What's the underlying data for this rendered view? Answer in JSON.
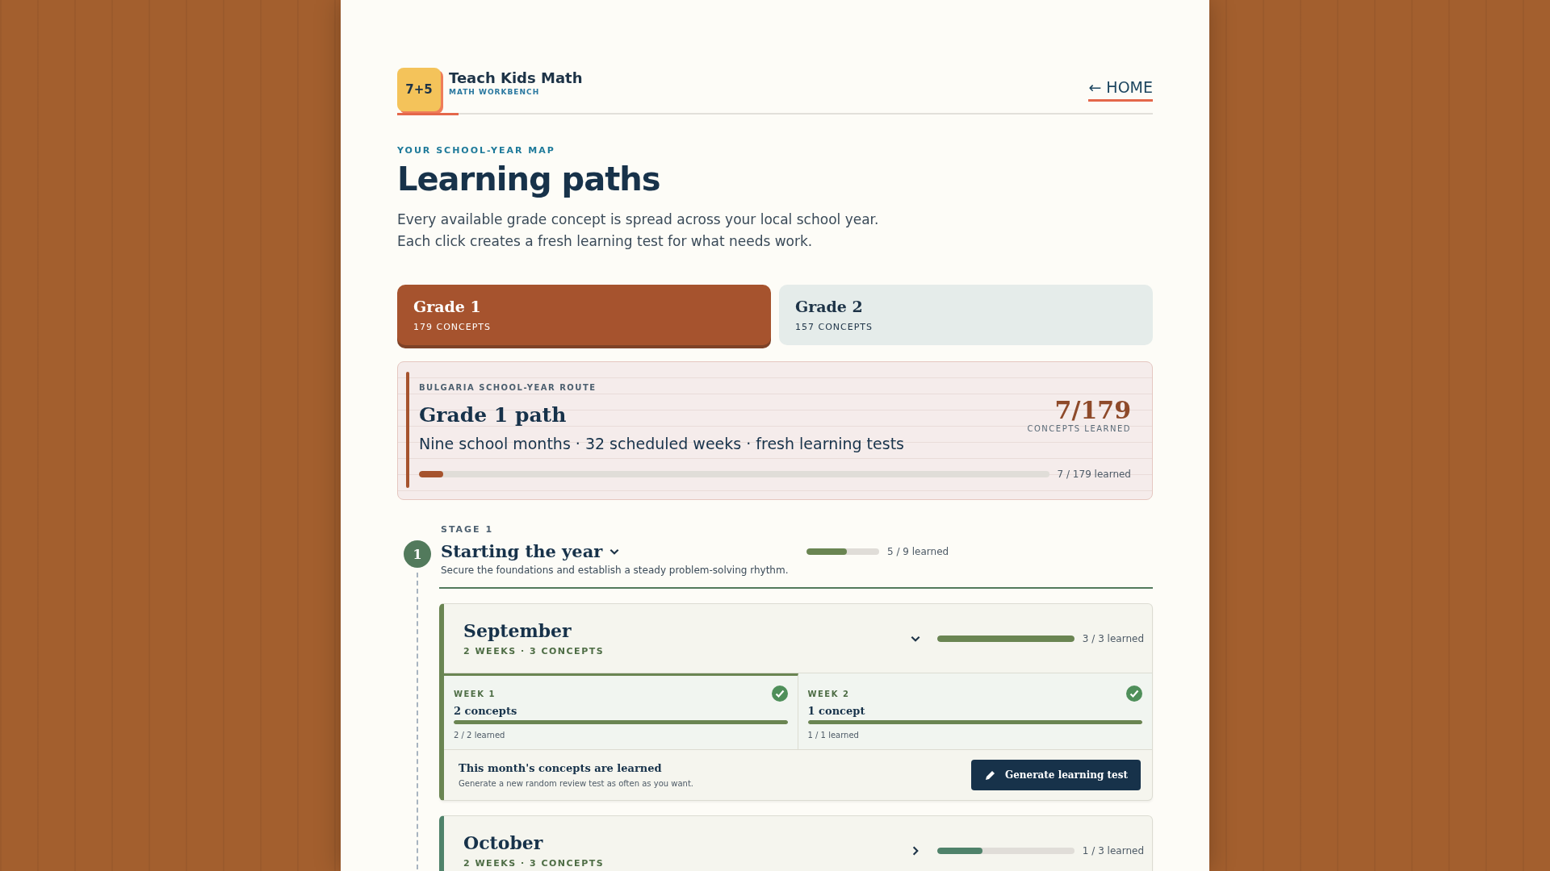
{
  "brand": {
    "logo": "7+5",
    "name": "Teach Kids Math",
    "tagline": "MATH WORKBENCH"
  },
  "nav": {
    "home": "← HOME"
  },
  "intro": {
    "eyebrow": "YOUR SCHOOL-YEAR MAP",
    "title": "Learning paths",
    "lines": [
      "Every available grade concept is spread across your local school year.",
      "Each click creates a fresh learning test for what needs work."
    ]
  },
  "tabs": [
    {
      "label": "Grade 1",
      "count": "179 CONCEPTS",
      "selected": true
    },
    {
      "label": "Grade 2",
      "count": "157 CONCEPTS",
      "selected": false
    }
  ],
  "path": {
    "eyebrow": "BULGARIA SCHOOL-YEAR ROUTE",
    "title": "Grade 1 path",
    "subtitle": "Nine school months · 32 scheduled weeks · fresh learning tests",
    "stat": "7/179",
    "stat_label": "CONCEPTS LEARNED",
    "level": 0.039,
    "reading": "7 / 179 learned"
  },
  "stages": [
    {
      "number": "1",
      "label": "STAGE 1",
      "title": "Starting the year",
      "expanded": true,
      "description": "Secure the foundations and establish a steady problem-solving rhythm.",
      "level": 0.556,
      "reading": "5 / 9 learned",
      "months": [
        {
          "name": "September",
          "meta": "2 WEEKS · 3 CONCEPTS",
          "expanded": true,
          "level": 1,
          "reading": "3 / 3 learned",
          "weeks": [
            {
              "label": "WEEK 1",
              "done": true,
              "title": "2 concepts",
              "level": 1,
              "reading": "2 / 2 learned"
            },
            {
              "label": "WEEK 2",
              "done": true,
              "title": "1 concept",
              "level": 1,
              "reading": "1 / 1 learned"
            }
          ],
          "footer": {
            "title": "This month's concepts are learned",
            "text": "Generate a new random review test as often as you want.",
            "button": "Generate learning test"
          }
        },
        {
          "name": "October",
          "meta": "2 WEEKS · 3 CONCEPTS",
          "expanded": false,
          "level": 0.333,
          "reading": "1 / 3 learned"
        }
      ]
    }
  ]
}
